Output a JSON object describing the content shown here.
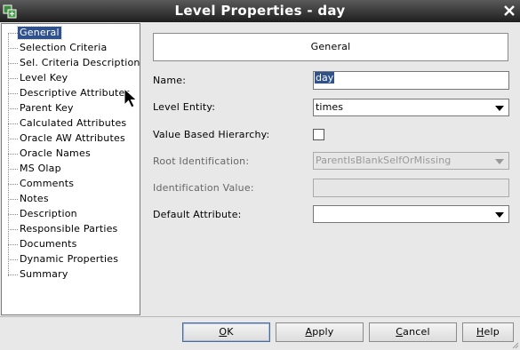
{
  "window": {
    "title": "Level Properties - day"
  },
  "nav": {
    "items": [
      {
        "label": "General",
        "selected": true
      },
      {
        "label": "Selection Criteria"
      },
      {
        "label": "Sel. Criteria Description"
      },
      {
        "label": "Level Key"
      },
      {
        "label": "Descriptive Attributes"
      },
      {
        "label": "Parent Key"
      },
      {
        "label": "Calculated Attributes"
      },
      {
        "label": "Oracle AW Attributes"
      },
      {
        "label": "Oracle Names"
      },
      {
        "label": "MS Olap"
      },
      {
        "label": "Comments"
      },
      {
        "label": "Notes"
      },
      {
        "label": "Description"
      },
      {
        "label": "Responsible Parties"
      },
      {
        "label": "Documents"
      },
      {
        "label": "Dynamic Properties"
      },
      {
        "label": "Summary"
      }
    ]
  },
  "panel": {
    "header": "General",
    "name_label": "Name:",
    "name_value": "day",
    "level_entity_label": "Level Entity:",
    "level_entity_value": "times",
    "value_based_label": "Value Based Hierarchy:",
    "value_based_checked": false,
    "root_id_label": "Root Identification:",
    "root_id_value": "ParentIsBlankSelfOrMissing",
    "ident_value_label": "Identification Value:",
    "ident_value": "",
    "default_attr_label": "Default Attribute:",
    "default_attr_value": ""
  },
  "buttons": {
    "ok_mnemonic": "O",
    "ok_rest": "K",
    "apply_mnemonic": "A",
    "apply_rest": "pply",
    "cancel_mnemonic": "C",
    "cancel_rest": "ancel",
    "help_mnemonic": "H",
    "help_rest": "elp"
  },
  "colors": {
    "selection": "#30528c",
    "titlebar": "#2a2a2a"
  },
  "icons": {
    "app": "level-entity-icon",
    "close": "close-x-icon",
    "cursor": "mouse-pointer-icon"
  }
}
